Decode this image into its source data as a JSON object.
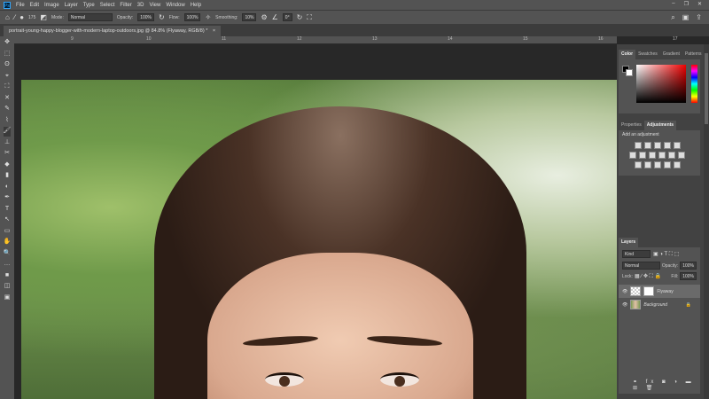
{
  "app": {
    "logo": "Ps"
  },
  "menu": [
    "File",
    "Edit",
    "Image",
    "Layer",
    "Type",
    "Select",
    "Filter",
    "3D",
    "View",
    "Window",
    "Help"
  ],
  "window_controls": {
    "minimize": "–",
    "restore": "❐",
    "close": "✕"
  },
  "options": {
    "brush_size": "175",
    "mode_label": "Mode:",
    "mode_value": "Normal",
    "opacity_label": "Opacity:",
    "opacity_value": "100%",
    "flow_label": "Flow:",
    "flow_value": "100%",
    "smoothing_label": "Smoothing:",
    "smoothing_value": "10%",
    "angle_value": "0°"
  },
  "document_tab": {
    "title": "portrait-young-happy-blogger-with-modern-laptop-outdoors.jpg @ 84.8% (Flyaway, RGB/8) *",
    "close": "×"
  },
  "ruler": [
    "9",
    "10",
    "11",
    "12",
    "13",
    "14",
    "15",
    "16",
    "17"
  ],
  "tools": [
    "✥",
    "⬚",
    "ʘ",
    "⌖",
    "⛶",
    "✕",
    "✎",
    "⌇",
    "🖌",
    "⊥",
    "✂",
    "◆",
    "▮",
    "◐",
    "✒",
    "T",
    "↖",
    "▭",
    "✋",
    "🔍",
    "…",
    "■",
    "◫",
    "▣"
  ],
  "color_panel": {
    "tabs": [
      "Color",
      "Swatches",
      "Gradient",
      "Patterns"
    ],
    "active": "Color"
  },
  "adjustments_panel": {
    "tabs": [
      "Properties",
      "Adjustments"
    ],
    "active": "Adjustments",
    "heading": "Add an adjustment"
  },
  "layers_panel": {
    "tab": "Layers",
    "filter": "Kind",
    "blend_mode": "Normal",
    "opacity_label": "Opacity:",
    "opacity_value": "100%",
    "lock_label": "Lock:",
    "fill_label": "Fill:",
    "fill_value": "100%",
    "layers": [
      {
        "name": "Flyaway",
        "visible": true
      },
      {
        "name": "Background",
        "visible": true,
        "locked": true
      }
    ]
  }
}
